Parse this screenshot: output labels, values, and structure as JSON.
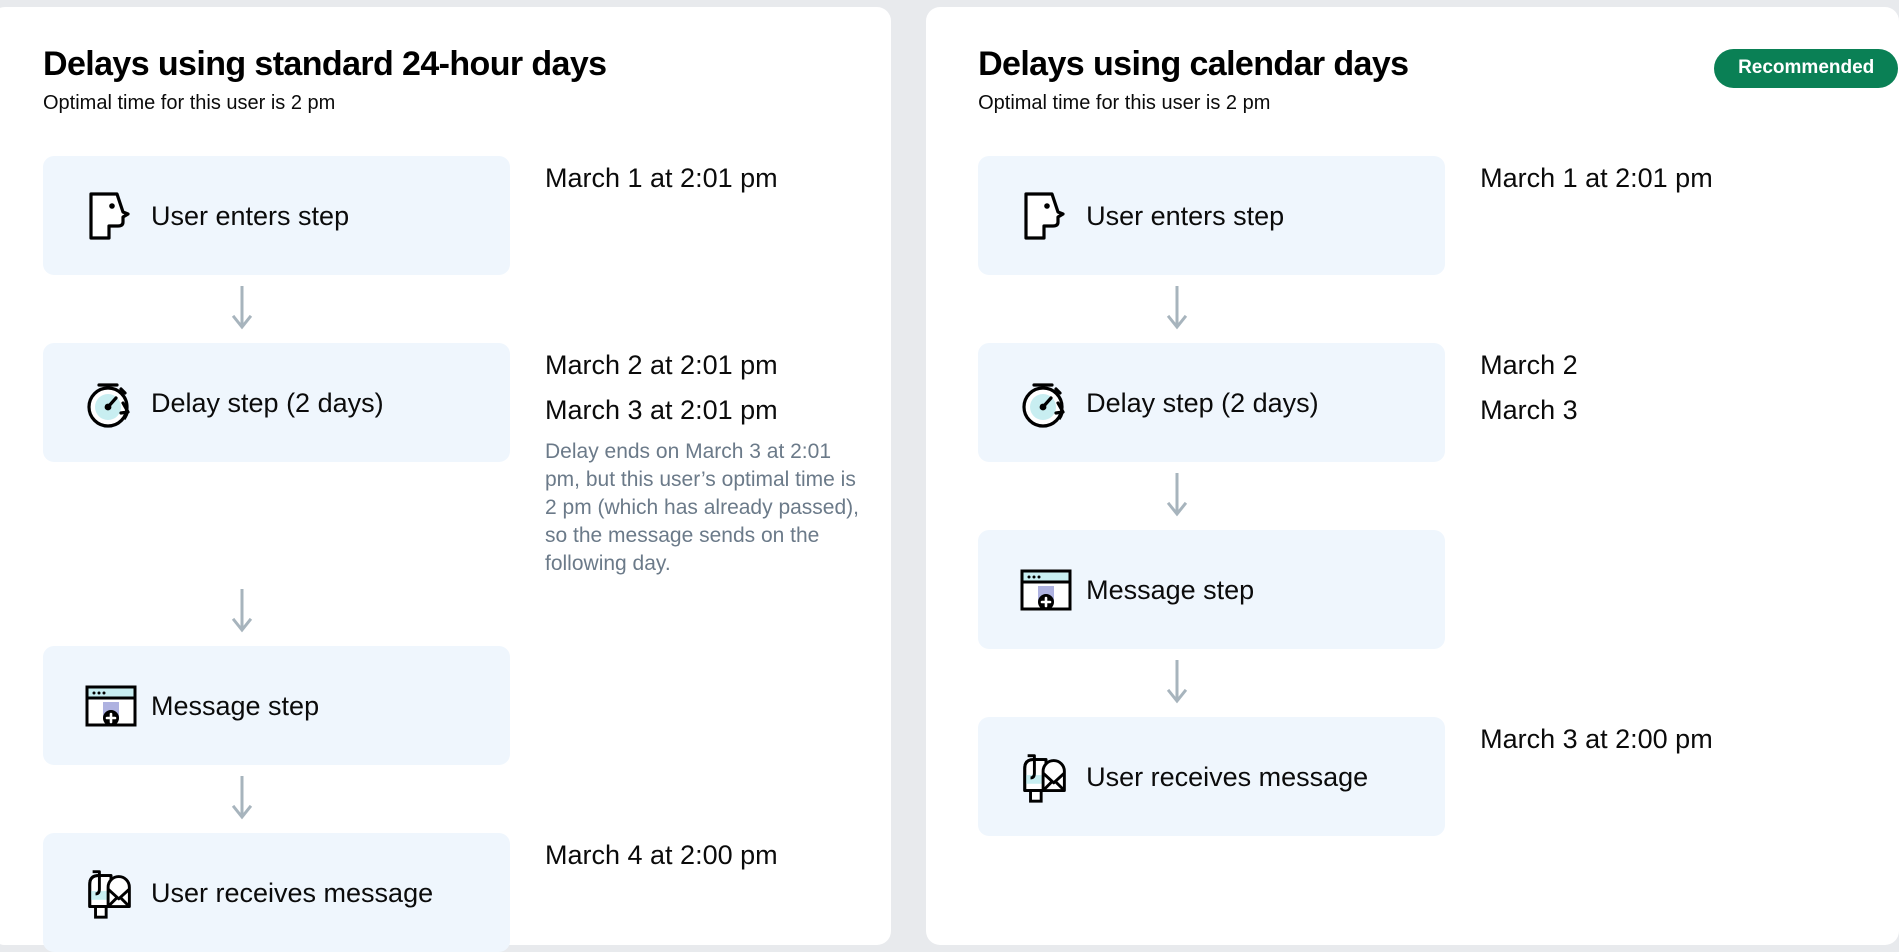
{
  "panels": [
    {
      "id": "standard-24-hour-days",
      "title": "Delays using standard 24-hour days",
      "subtitle": "Optimal time for this user is 2 pm",
      "badge": null,
      "steps": [
        {
          "icon": "user-enters-step-icon",
          "label": "User enters step",
          "dates": [
            "March 1 at 2:01 pm"
          ],
          "note": null
        },
        {
          "icon": "delay-step-icon",
          "label": "Delay step (2 days)",
          "dates": [
            "March 2 at 2:01 pm",
            "March 3 at 2:01 pm"
          ],
          "note": "Delay ends on March 3 at 2:01 pm, but this user’s optimal time is 2 pm (which has already passed), so the message sends on the following day."
        },
        {
          "icon": "message-step-icon",
          "label": "Message step",
          "dates": [],
          "note": null
        },
        {
          "icon": "user-receives-message-icon",
          "label": "User receives message",
          "dates": [
            "March 4 at 2:00 pm"
          ],
          "note": null
        }
      ]
    },
    {
      "id": "calendar-days",
      "title": "Delays using calendar days",
      "subtitle": "Optimal time for this user is 2 pm",
      "badge": "Recommended",
      "steps": [
        {
          "icon": "user-enters-step-icon",
          "label": "User enters step",
          "dates": [
            "March 1 at 2:01 pm"
          ],
          "note": null
        },
        {
          "icon": "delay-step-icon",
          "label": "Delay step (2 days)",
          "dates": [
            "March 2",
            "March 3"
          ],
          "note": null
        },
        {
          "icon": "message-step-icon",
          "label": "Message step",
          "dates": [],
          "note": null
        },
        {
          "icon": "user-receives-message-icon",
          "label": "User receives message",
          "dates": [
            "March 3 at 2:00 pm"
          ],
          "note": null
        }
      ]
    }
  ],
  "colors": {
    "page_background": "#e8eaed",
    "card_background": "#ffffff",
    "step_background": "#eff6fd",
    "badge_background": "#0a8055",
    "badge_text": "#ffffff",
    "note_text": "#6b7a89",
    "arrow": "#a7b4bd",
    "icon_accent_cyan": "#c8eef1",
    "icon_accent_purple": "#aeb2e0"
  }
}
